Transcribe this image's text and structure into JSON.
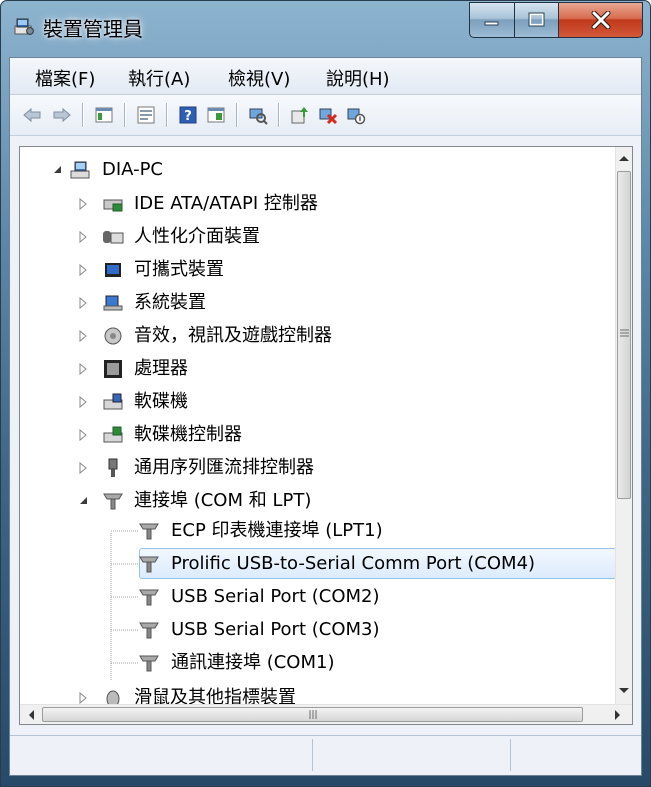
{
  "window": {
    "title": "裝置管理員",
    "icon": "device-manager-icon",
    "caption_buttons": [
      "minimize-icon",
      "maximize-icon",
      "close-icon"
    ]
  },
  "menu": {
    "items": [
      "檔案(F)",
      "執行(A)",
      "檢視(V)",
      "說明(H)"
    ]
  },
  "toolbar": {
    "icons": [
      "back-icon",
      "forward-icon",
      "properties-icon",
      "console-tree-icon",
      "help-icon",
      "show-hide-icon",
      "scan-hardware-icon",
      "update-driver-icon",
      "uninstall-icon",
      "disable-icon"
    ]
  },
  "tree": {
    "root": {
      "label": "DIA-PC",
      "icon": "computer-icon",
      "expanded": true
    },
    "categories": [
      {
        "label": "IDE ATA/ATAPI 控制器",
        "icon": "ide-controller-icon"
      },
      {
        "label": "人性化介面裝置",
        "icon": "hid-icon"
      },
      {
        "label": "可攜式裝置",
        "icon": "portable-device-icon"
      },
      {
        "label": "系統裝置",
        "icon": "system-device-icon"
      },
      {
        "label": "音效，視訊及遊戲控制器",
        "icon": "sound-icon"
      },
      {
        "label": "處理器",
        "icon": "processor-icon"
      },
      {
        "label": "軟碟機",
        "icon": "floppy-drive-icon"
      },
      {
        "label": "軟碟機控制器",
        "icon": "floppy-controller-icon"
      },
      {
        "label": "通用序列匯流排控制器",
        "icon": "usb-controller-icon"
      },
      {
        "label": "連接埠 (COM 和 LPT)",
        "icon": "port-icon",
        "expanded": true
      },
      {
        "label": "滑鼠及其他指標裝置",
        "icon": "mouse-icon"
      }
    ],
    "ports": [
      {
        "label": "ECP 印表機連接埠 (LPT1)",
        "icon": "port-icon"
      },
      {
        "label": "Prolific USB-to-Serial Comm Port (COM4)",
        "icon": "port-icon",
        "selected": true
      },
      {
        "label": "USB Serial Port (COM2)",
        "icon": "port-icon"
      },
      {
        "label": "USB Serial Port (COM3)",
        "icon": "port-icon"
      },
      {
        "label": "通訊連接埠 (COM1)",
        "icon": "port-icon"
      }
    ]
  },
  "colors": {
    "selection_border": "#99c3ef",
    "selection_fill": "#dcebfc",
    "title_bar": "#5e88a9",
    "close_button": "#c1381a"
  }
}
